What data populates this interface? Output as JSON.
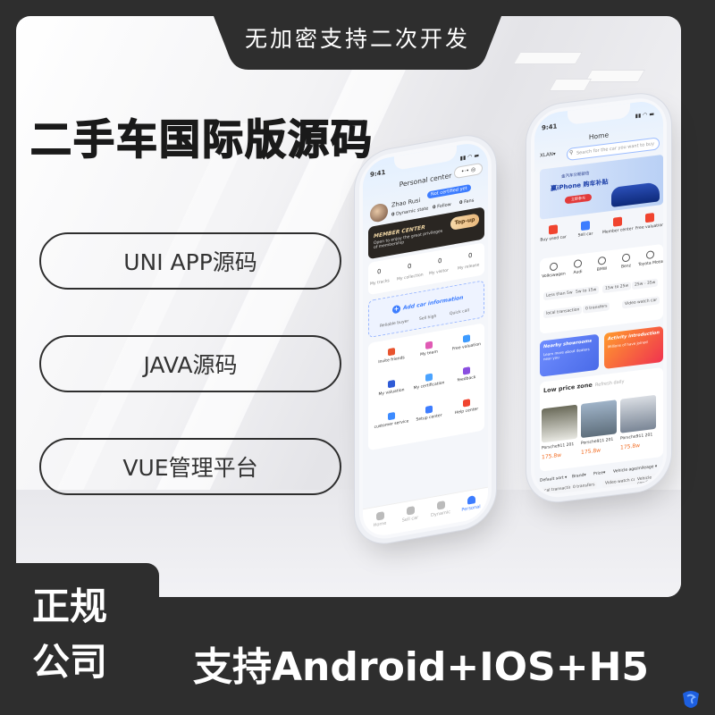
{
  "top_banner": {
    "text": "无加密支持二次开发"
  },
  "main_title": "二手车国际版源码",
  "features": [
    {
      "label": "UNI APP源码"
    },
    {
      "label": "JAVA源码"
    },
    {
      "label": "VUE管理平台"
    }
  ],
  "bottom": {
    "company_line1": "正规",
    "company_line2": "公司",
    "platforms": "支持Android+IOS+H5"
  },
  "phone_personal": {
    "status_time": "9:41",
    "title": "Personal center",
    "capsule": "•·•  ◎",
    "user": {
      "name": "Zhao Rusi",
      "badge": "Not certified yet",
      "stats": [
        {
          "value": "0",
          "label": "Dynamic state"
        },
        {
          "value": "0",
          "label": "Follow"
        },
        {
          "value": "0",
          "label": "Fans"
        }
      ]
    },
    "member": {
      "title": "MEMBER CENTER",
      "desc": "Open to enjoy the great privileges of membership",
      "topup_label": "Top-up"
    },
    "counters": [
      {
        "value": "0",
        "label": "My tracks"
      },
      {
        "value": "0",
        "label": "My collection"
      },
      {
        "value": "0",
        "label": "My visitor"
      },
      {
        "value": "0",
        "label": "My release"
      }
    ],
    "add_car": {
      "title": "Add car information",
      "tags": [
        "Reliable buyer",
        "Sell high",
        "Quick call"
      ]
    },
    "services": [
      {
        "label": "Invite friends",
        "icon": "invite-icon",
        "color": "#e8542f"
      },
      {
        "label": "My team",
        "icon": "team-icon",
        "color": "#e05ab4"
      },
      {
        "label": "Free valuation",
        "icon": "valuation-icon",
        "color": "#3d9bff"
      },
      {
        "label": "My valuation",
        "icon": "my-valuation-icon",
        "color": "#2f5bd6"
      },
      {
        "label": "My certification",
        "icon": "certification-icon",
        "color": "#4aa3ff"
      },
      {
        "label": "feedback",
        "icon": "feedback-icon",
        "color": "#8a4fe0"
      },
      {
        "label": "customer service",
        "icon": "customer-service-icon",
        "color": "#3d8bff"
      },
      {
        "label": "Setup center",
        "icon": "settings-icon",
        "color": "#3d7dff"
      },
      {
        "label": "Help center",
        "icon": "help-icon",
        "color": "#f0442f"
      }
    ],
    "tabbar": [
      {
        "label": "Home",
        "icon": "home-icon",
        "active": false
      },
      {
        "label": "Sell car",
        "icon": "car-icon",
        "active": false
      },
      {
        "label": "Dynamic",
        "icon": "location-icon",
        "active": false
      },
      {
        "label": "Personal",
        "icon": "person-icon",
        "active": true
      }
    ]
  },
  "phone_home": {
    "status_time": "9:41",
    "title": "Home",
    "city": "XLAN",
    "search_placeholder": "Search for the car you want to buy",
    "banner": {
      "line1": "金汽车分期部信",
      "line2": "赢iPhone 购车补贴",
      "button": "立即参与"
    },
    "quick_nav": [
      {
        "label": "Buy used car",
        "color": "#f0442f"
      },
      {
        "label": "Sell car",
        "color": "#3d7dff"
      },
      {
        "label": "Member center",
        "color": "#f0442f"
      },
      {
        "label": "Free valuation",
        "color": "#f0442f"
      }
    ],
    "brands": [
      "Volkswagen",
      "Audi",
      "BMW",
      "Benz",
      "Toyota Motor"
    ],
    "price_filters": [
      "Less than 5w",
      "5w to 15w",
      "15w to 25w",
      "25w - 35w"
    ],
    "tag_filters": [
      "local transaction",
      "0 transfers",
      "Video watch car"
    ],
    "promos": [
      {
        "title": "Nearby showrooms",
        "desc": "Learn more about dealers near you"
      },
      {
        "title": "Activity introduction",
        "desc": "Millions of have joined"
      }
    ],
    "zone_tabs": [
      {
        "label": "Low price zone",
        "active": true
      },
      {
        "label": "Refresh daily",
        "active": false
      }
    ],
    "cars": [
      {
        "name": "Porsche911 201",
        "price": "175.8w"
      },
      {
        "name": "Porsche911 201",
        "price": "175.8w"
      },
      {
        "name": "Porsche911 201",
        "price": "175.8w"
      }
    ],
    "sort_bar": [
      "Default sort ▾",
      "Brand▾",
      "Price▾",
      "Vehicle age/mileage ▾"
    ],
    "bottom_chips": [
      "local transaction",
      "0 transfers",
      "Video watch car",
      "Vehicle condit"
    ]
  }
}
